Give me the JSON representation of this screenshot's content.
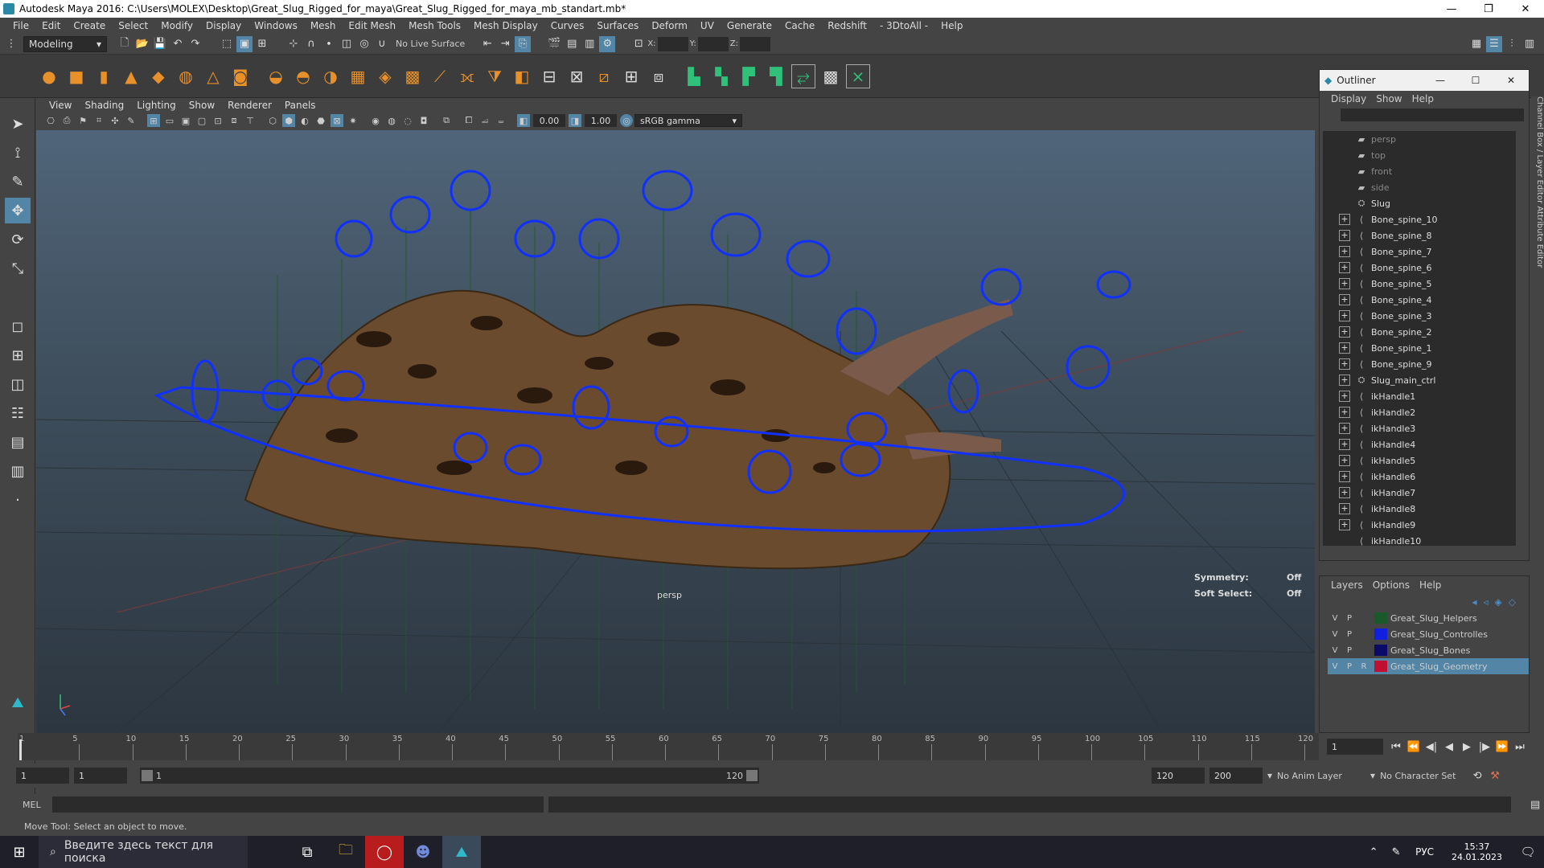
{
  "window": {
    "title": "Autodesk Maya 2016: C:\\Users\\MOLEX\\Desktop\\Great_Slug_Rigged_for_maya\\Great_Slug_Rigged_for_maya_mb_standart.mb*",
    "minimize": "—",
    "maximize": "❐",
    "close": "✕"
  },
  "menubar": [
    "File",
    "Edit",
    "Create",
    "Select",
    "Modify",
    "Display",
    "Windows",
    "Mesh",
    "Edit Mesh",
    "Mesh Tools",
    "Mesh Display",
    "Curves",
    "Surfaces",
    "Deform",
    "UV",
    "Generate",
    "Cache",
    "Redshift",
    "- 3DtoAll -",
    "Help"
  ],
  "statusline": {
    "mode": "Modeling",
    "live_surface": "No Live Surface",
    "x_label": "X:",
    "y_label": "Y:",
    "z_label": "Z:"
  },
  "viewport": {
    "menu": [
      "View",
      "Shading",
      "Lighting",
      "Show",
      "Renderer",
      "Panels"
    ],
    "exposure": "0.00",
    "gamma": "1.00",
    "color_space": "sRGB gamma",
    "camera_label": "persp",
    "hud": {
      "symmetry_label": "Symmetry:",
      "symmetry_value": "Off",
      "soft_select_label": "Soft Select:",
      "soft_select_value": "Off"
    }
  },
  "outliner": {
    "title": "Outliner",
    "menu": [
      "Display",
      "Show",
      "Help"
    ],
    "items": [
      {
        "label": "persp",
        "kind": "camera",
        "expand": false,
        "dim": true
      },
      {
        "label": "top",
        "kind": "camera",
        "expand": false,
        "dim": true
      },
      {
        "label": "front",
        "kind": "camera",
        "expand": false,
        "dim": true
      },
      {
        "label": "side",
        "kind": "camera",
        "expand": false,
        "dim": true
      },
      {
        "label": "Slug",
        "kind": "group",
        "expand": false,
        "dim": false
      },
      {
        "label": "Bone_spine_10",
        "kind": "joint",
        "expand": true,
        "dim": false
      },
      {
        "label": "Bone_spine_8",
        "kind": "joint",
        "expand": true,
        "dim": false
      },
      {
        "label": "Bone_spine_7",
        "kind": "joint",
        "expand": true,
        "dim": false
      },
      {
        "label": "Bone_spine_6",
        "kind": "joint",
        "expand": true,
        "dim": false
      },
      {
        "label": "Bone_spine_5",
        "kind": "joint",
        "expand": true,
        "dim": false
      },
      {
        "label": "Bone_spine_4",
        "kind": "joint",
        "expand": true,
        "dim": false
      },
      {
        "label": "Bone_spine_3",
        "kind": "joint",
        "expand": true,
        "dim": false
      },
      {
        "label": "Bone_spine_2",
        "kind": "joint",
        "expand": true,
        "dim": false
      },
      {
        "label": "Bone_spine_1",
        "kind": "joint",
        "expand": true,
        "dim": false
      },
      {
        "label": "Bone_spine_9",
        "kind": "joint",
        "expand": true,
        "dim": false
      },
      {
        "label": "Slug_main_ctrl",
        "kind": "group",
        "expand": true,
        "dim": false
      },
      {
        "label": "ikHandle1",
        "kind": "ik",
        "expand": true,
        "dim": false
      },
      {
        "label": "ikHandle2",
        "kind": "ik",
        "expand": true,
        "dim": false
      },
      {
        "label": "ikHandle3",
        "kind": "ik",
        "expand": true,
        "dim": false
      },
      {
        "label": "ikHandle4",
        "kind": "ik",
        "expand": true,
        "dim": false
      },
      {
        "label": "ikHandle5",
        "kind": "ik",
        "expand": true,
        "dim": false
      },
      {
        "label": "ikHandle6",
        "kind": "ik",
        "expand": true,
        "dim": false
      },
      {
        "label": "ikHandle7",
        "kind": "ik",
        "expand": true,
        "dim": false
      },
      {
        "label": "ikHandle8",
        "kind": "ik",
        "expand": true,
        "dim": false
      },
      {
        "label": "ikHandle9",
        "kind": "ik",
        "expand": true,
        "dim": false
      },
      {
        "label": "ikHandle10",
        "kind": "ik",
        "expand": false,
        "dim": false
      }
    ]
  },
  "layers": {
    "menu": [
      "Layers",
      "Options",
      "Help"
    ],
    "rows": [
      {
        "v": "V",
        "p": "P",
        "r": "",
        "name": "Great_Slug_Helpers",
        "color": "#1a5a2a",
        "selected": false
      },
      {
        "v": "V",
        "p": "P",
        "r": "",
        "name": "Great_Slug_Controlles",
        "color": "#1020e0",
        "selected": false
      },
      {
        "v": "V",
        "p": "P",
        "r": "",
        "name": "Great_Slug_Bones",
        "color": "#0a0a6a",
        "selected": false
      },
      {
        "v": "V",
        "p": "P",
        "r": "R",
        "name": "Great_Slug_Geometry",
        "color": "#c01030",
        "selected": true
      }
    ]
  },
  "sidetab": "Channel Box / Layer Editor    Attribute Editor",
  "timeline": {
    "ticks": [
      "5",
      "10",
      "15",
      "20",
      "25",
      "30",
      "35",
      "40",
      "45",
      "50",
      "55",
      "60",
      "65",
      "70",
      "75",
      "80",
      "85",
      "90",
      "95",
      "100",
      "105",
      "110",
      "115",
      "120"
    ],
    "first_tick": "1",
    "current_frame": "1"
  },
  "range": {
    "start": "1",
    "playback_start": "1",
    "slider_start": "1",
    "slider_end": "120",
    "playback_end": "120",
    "end": "200",
    "anim_layer": "No Anim Layer",
    "character_set": "No Character Set"
  },
  "mel": {
    "label": "MEL"
  },
  "help_line": "Move Tool: Select an object to move.",
  "taskbar": {
    "search_placeholder": "Введите здесь текст для поиска",
    "lang": "РУС",
    "time": "15:37",
    "date": "24.01.2023"
  }
}
